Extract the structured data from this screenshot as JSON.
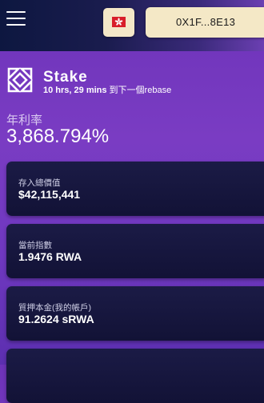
{
  "header": {
    "menu_icon": "hamburger-menu-icon",
    "language_flag": "hong-kong-flag-icon",
    "wallet_address": "0X1F...8E13"
  },
  "stake": {
    "logo_icon": "stake-logo-icon",
    "title": "Stake",
    "rebase_time": "10 hrs, 29 mins",
    "rebase_suffix": " 到下一個rebase"
  },
  "apy": {
    "label": "年利率",
    "value": "3,868.794%"
  },
  "cards": [
    {
      "label": "存入總價值",
      "value": "$42,115,441"
    },
    {
      "label": "當前指數",
      "value": "1.9476 RWA"
    },
    {
      "label": "質押本金(我的帳戶)",
      "value": "91.2624 sRWA"
    }
  ],
  "colors": {
    "background_purple": "#7a3cc3",
    "header_navy": "#0d1740",
    "card_navy": "#141439",
    "button_cream": "#f4e8c6"
  }
}
